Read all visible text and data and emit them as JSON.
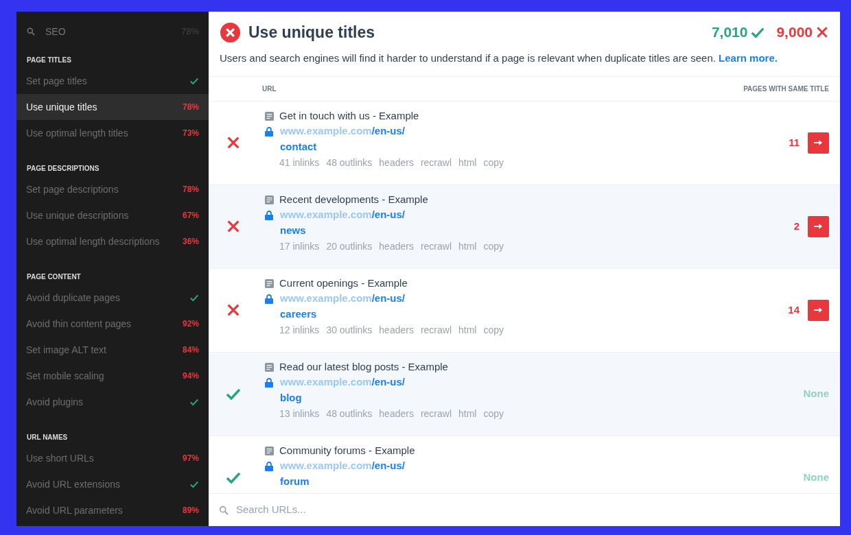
{
  "sidebar": {
    "search": {
      "value": "SEO",
      "score": "78%"
    },
    "sections": [
      {
        "title": "PAGE TITLES",
        "items": [
          {
            "label": "Set page titles",
            "passed": true,
            "selected": false
          },
          {
            "label": "Use unique titles",
            "passed": false,
            "score": "78%",
            "selected": true
          },
          {
            "label": "Use optimal length titles",
            "passed": false,
            "score": "73%",
            "selected": false
          }
        ]
      },
      {
        "title": "PAGE DESCRIPTIONS",
        "items": [
          {
            "label": "Set page descriptions",
            "passed": false,
            "score": "78%",
            "selected": false
          },
          {
            "label": "Use unique descriptions",
            "passed": false,
            "score": "67%",
            "selected": false
          },
          {
            "label": "Use optimal length descriptions",
            "passed": false,
            "score": "36%",
            "selected": false
          }
        ]
      },
      {
        "title": "PAGE CONTENT",
        "items": [
          {
            "label": "Avoid duplicate pages",
            "passed": true,
            "selected": false
          },
          {
            "label": "Avoid thin content pages",
            "passed": false,
            "score": "92%",
            "selected": false
          },
          {
            "label": "Set image ALT text",
            "passed": false,
            "score": "84%",
            "selected": false
          },
          {
            "label": "Set mobile scaling",
            "passed": false,
            "score": "94%",
            "selected": false
          },
          {
            "label": "Avoid plugins",
            "passed": true,
            "selected": false
          }
        ]
      },
      {
        "title": "URL NAMES",
        "items": [
          {
            "label": "Use short URLs",
            "passed": false,
            "score": "97%",
            "selected": false
          },
          {
            "label": "Avoid URL extensions",
            "passed": true,
            "selected": false
          },
          {
            "label": "Avoid URL parameters",
            "passed": false,
            "score": "89%",
            "selected": false
          }
        ]
      }
    ]
  },
  "main": {
    "title": "Use unique titles",
    "passed": false,
    "pass_count": "7,010",
    "fail_count": "9,000",
    "description": "Users and search engines will find it harder to understand if a page is relevant when duplicate titles are seen.",
    "learn_more": "Learn more.",
    "columns": [
      "URL",
      "PAGES WITH SAME TITLE"
    ],
    "rows": [
      {
        "title": "Get in touch with us - Example",
        "domain": "www.example.com",
        "path": "/en-us/",
        "slug": "contact",
        "links": [
          "41 inlinks",
          "48 outlinks",
          "headers",
          "recrawl",
          "html",
          "copy"
        ],
        "passed": false,
        "count": "11"
      },
      {
        "title": "Recent developments - Example",
        "domain": "www.example.com",
        "path": "/en-us/",
        "slug": "news",
        "links": [
          "17 inlinks",
          "20 outlinks",
          "headers",
          "recrawl",
          "html",
          "copy"
        ],
        "passed": false,
        "count": "2"
      },
      {
        "title": "Current openings - Example",
        "domain": "www.example.com",
        "path": "/en-us/",
        "slug": "careers",
        "links": [
          "12 inlinks",
          "30 outlinks",
          "headers",
          "recrawl",
          "html",
          "copy"
        ],
        "passed": false,
        "count": "14"
      },
      {
        "title": "Read our latest blog posts - Example",
        "domain": "www.example.com",
        "path": "/en-us/",
        "slug": "blog",
        "links": [
          "13 inlinks",
          "48 outlinks",
          "headers",
          "recrawl",
          "html",
          "copy"
        ],
        "passed": true,
        "count": "None"
      },
      {
        "title": "Community forums - Example",
        "domain": "www.example.com",
        "path": "/en-us/",
        "slug": "forum",
        "passed": true,
        "count": "None"
      }
    ],
    "search": {
      "placeholder": "Search URLs..."
    }
  }
}
